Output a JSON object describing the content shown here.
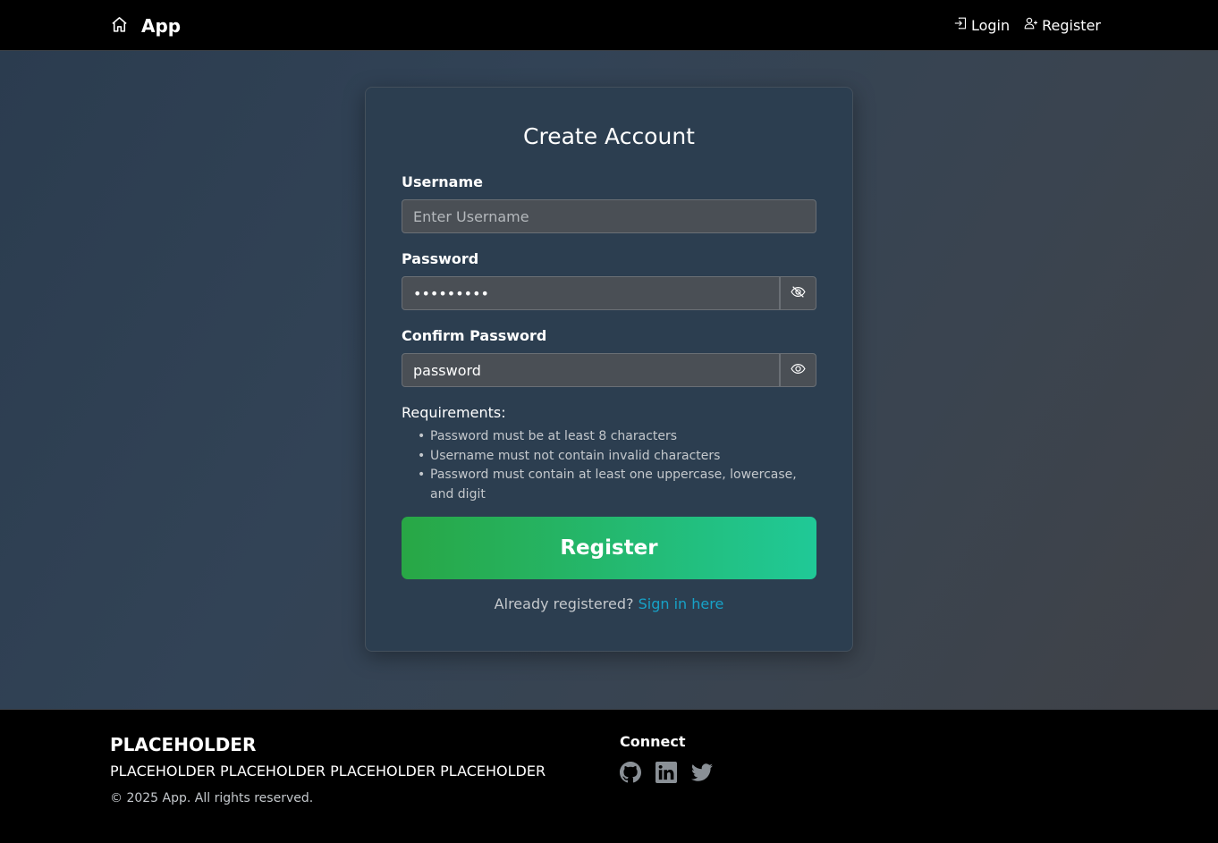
{
  "navbar": {
    "brand": "App",
    "brand_icon": "house-icon",
    "links": [
      {
        "label": "Login",
        "icon": "login-icon"
      },
      {
        "label": "Register",
        "icon": "user-plus-icon"
      }
    ]
  },
  "form": {
    "title": "Create Account",
    "username": {
      "label": "Username",
      "placeholder": "Enter Username",
      "value": ""
    },
    "password": {
      "label": "Password",
      "value": "•••••••••",
      "toggle_icon": "eye-slash-icon"
    },
    "confirm_password": {
      "label": "Confirm Password",
      "value": "password",
      "toggle_icon": "eye-icon"
    },
    "requirements_title": "Requirements:",
    "requirements": [
      "Password must be at least 8 characters",
      "Username must not contain invalid characters",
      "Password must contain at least one uppercase, lowercase, and digit"
    ],
    "submit_label": "Register",
    "signin_prompt": "Already registered?",
    "signin_link": "Sign in here"
  },
  "footer": {
    "brand": "PLACEHOLDER",
    "description": "PLACEHOLDER PLACEHOLDER PLACEHOLDER PLACEHOLDER",
    "copyright": "© 2025 App. All rights reserved.",
    "connect_title": "Connect",
    "socials": [
      "github-icon",
      "linkedin-icon",
      "twitter-icon"
    ]
  },
  "colors": {
    "accent_gradient_start": "#28a745",
    "accent_gradient_end": "#20c997",
    "link": "#17a2c8",
    "card_bg": "#2c3e50"
  }
}
